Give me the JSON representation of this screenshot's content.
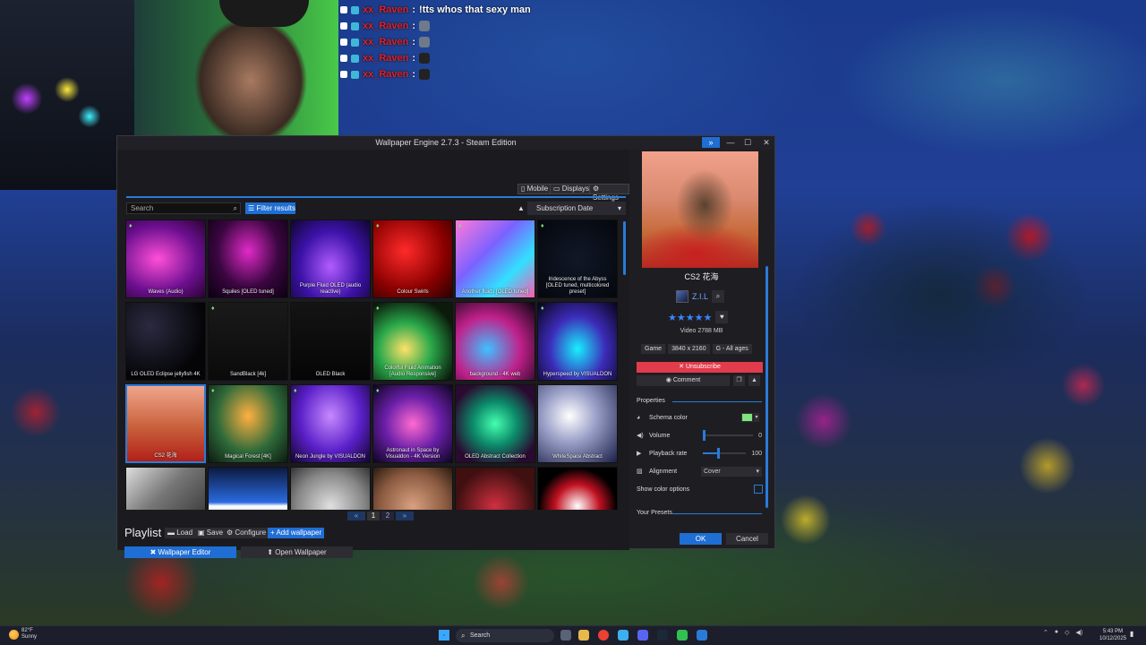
{
  "chat": {
    "lines": [
      {
        "user": "xx_Raven",
        "message": "!tts whos that sexy man"
      },
      {
        "user": "xx_Raven",
        "message": ""
      },
      {
        "user": "xx_Raven",
        "message": ""
      },
      {
        "user": "xx_Raven",
        "message": ""
      },
      {
        "user": "xx_Raven",
        "message": ""
      }
    ],
    "separator": ":"
  },
  "window": {
    "title": "Wallpaper Engine 2.7.3 - Steam Edition",
    "collapse_glyph": "»",
    "minimize_glyph": "—",
    "maximize_glyph": "☐",
    "close_glyph": "✕"
  },
  "toolbar": {
    "mobile": "Mobile",
    "displays": "Displays",
    "settings": "Settings"
  },
  "browse": {
    "search_placeholder": "Search",
    "filter_label": "Filter results",
    "sort_arrow": "▲",
    "sort_value": "Subscription Date",
    "sort_caret": "▾"
  },
  "wallpapers": [
    {
      "title": "Waves (Audio)"
    },
    {
      "title": "Squiles [OLED tuned]"
    },
    {
      "title": "Purple Fluid OLED (audio reactive)"
    },
    {
      "title": "Colour Swirls"
    },
    {
      "title": "Another fluids [OLED tuned]"
    },
    {
      "title": "Iridescence of the Abyss [OLED tuned, multicolored preset]"
    },
    {
      "title": "LG OLED Eclipse jellyfish 4K"
    },
    {
      "title": "SandBlack [4k]"
    },
    {
      "title": "OLED Black"
    },
    {
      "title": "Colorful Fluid Animation [Audio Responsive]"
    },
    {
      "title": "background - 4K web"
    },
    {
      "title": "Hyperspeed by VISUALDON"
    },
    {
      "title": "CS2 花海"
    },
    {
      "title": "Magical Forest [4K]"
    },
    {
      "title": "Neon Jungle by VISUALDON"
    },
    {
      "title": "Astronaut in Space by Visualdon - 4K Version"
    },
    {
      "title": "OLED Abstract Collection"
    },
    {
      "title": "WhiteSpace Abstract"
    },
    {
      "title": ""
    },
    {
      "title": ""
    },
    {
      "title": ""
    },
    {
      "title": ""
    },
    {
      "title": ""
    },
    {
      "title": ""
    }
  ],
  "pager": {
    "prev": "«",
    "pages": [
      "1",
      "2"
    ],
    "next": "»"
  },
  "playlist": {
    "label": "Playlist",
    "load": "Load",
    "save": "Save",
    "configure": "Configure",
    "add": "+ Add wallpaper"
  },
  "footer": {
    "editor": "Wallpaper Editor",
    "open": "Open Wallpaper",
    "ok": "OK",
    "cancel": "Cancel"
  },
  "details": {
    "title": "CS2 花海",
    "author": "Z.I.L",
    "stars": "★★★★★",
    "info": "Video  2788 MB",
    "tags": [
      "Game",
      "3840 x 2160",
      "G - All ages"
    ],
    "unsubscribe": "✕ Unsubscribe",
    "comment": "Comment",
    "properties_label": "Properties",
    "schema_color_label": "Schema color",
    "volume_label": "Volume",
    "volume_value": "0",
    "playback_label": "Playback rate",
    "playback_value": "100",
    "alignment_label": "Alignment",
    "alignment_value": "Cover",
    "show_color_label": "Show color options",
    "presets_label": "Your Presets",
    "schema_color": "#7fe37f",
    "volume_level": 0.0,
    "playback_level": 0.33
  },
  "taskbar": {
    "temp": "82°F",
    "condition": "Sunny",
    "search_label": "Search",
    "time": "5:43 PM",
    "date": "10/12/2025"
  },
  "colors": {
    "accent": "#1f6ed4",
    "danger": "#e23b4b",
    "chat_user": "#e02020"
  }
}
